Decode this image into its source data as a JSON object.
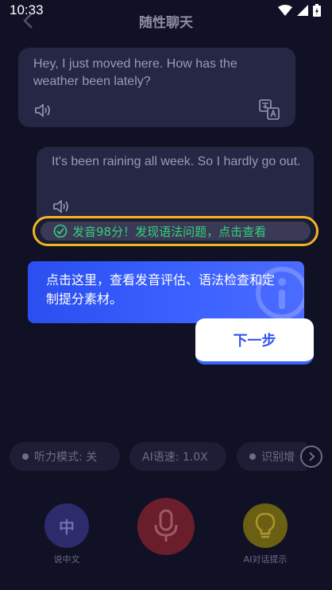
{
  "status_bar": {
    "time": "10:33"
  },
  "header": {
    "title": "随性聊天",
    "back_icon": "chevron-left-icon"
  },
  "chat": {
    "user_message": "Hey, I just moved here. How has the weather been lately?",
    "ai_message": "It's been raining all week. So I hardly go out.",
    "feedback": "发音98分！发现语法问题，点击查看"
  },
  "guide": {
    "text": "点击这里，查看发音评估、语法检查和定制提分素材。",
    "next_label": "下一步"
  },
  "chips": {
    "listen_mode": "听力模式: 关",
    "ai_speed": "AI语速: 1.0X",
    "recognition": "识别增"
  },
  "controls": {
    "chinese_glyph": "中",
    "chinese_label": "说中文",
    "hint_label": "AI对话提示"
  },
  "colors": {
    "background": "#111125",
    "bubble": "#262645",
    "highlight_border": "#f3b622",
    "success_green": "#33d17a",
    "guide_blue": "#3a60ff",
    "mic_red": "#6a1e2b",
    "hint_gold": "#6a5f12"
  }
}
